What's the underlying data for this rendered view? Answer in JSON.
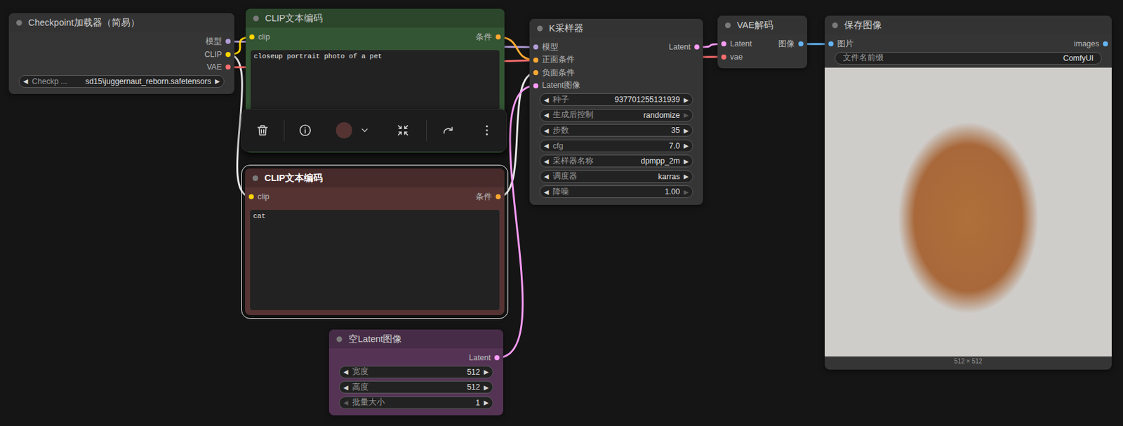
{
  "nodes": [
    {
      "title": "Checkpoint加载器（简易）",
      "color": "#353535",
      "title_color": "#333333",
      "selected": false,
      "inputs": [],
      "outputs": [
        {
          "label": "模型",
          "color": "#b39ddb"
        },
        {
          "label": "CLIP",
          "color": "#ffd500"
        },
        {
          "label": "VAE",
          "color": "#ff6e6e"
        }
      ],
      "widgets": [
        {
          "kind": "combo",
          "label": "Checkp ...",
          "value": "sd15\\juggernaut_reborn.safetensors",
          "left": "◀",
          "right": "▶",
          "left_disabled": false,
          "right_disabled": false
        }
      ]
    },
    {
      "title": "CLIP文本编码",
      "color": "#335533",
      "title_color": "#2b462b",
      "selected": false,
      "inputs": [
        {
          "label": "clip",
          "color": "#ffd500"
        }
      ],
      "outputs": [
        {
          "label": "条件",
          "color": "#ffa931"
        }
      ],
      "widgets": [
        {
          "kind": "text",
          "value": "closeup portrait photo of a pet"
        }
      ]
    },
    {
      "title": "CLIP文本编码",
      "color": "#553333",
      "title_color": "#472a2a",
      "selected": true,
      "inputs": [
        {
          "label": "clip",
          "color": "#ffd500"
        }
      ],
      "outputs": [
        {
          "label": "条件",
          "color": "#ffa931"
        }
      ],
      "widgets": [
        {
          "kind": "text",
          "value": "cat"
        }
      ]
    },
    {
      "title": "空Latent图像",
      "color": "#553355",
      "title_color": "#462c46",
      "selected": false,
      "inputs": [],
      "outputs": [
        {
          "label": "Latent",
          "color": "#ff9cf9"
        }
      ],
      "widgets": [
        {
          "kind": "number",
          "label": "宽度",
          "value": "512",
          "left": "◀",
          "right": "▶",
          "left_disabled": false,
          "right_disabled": false
        },
        {
          "kind": "number",
          "label": "高度",
          "value": "512",
          "left": "◀",
          "right": "▶",
          "left_disabled": false,
          "right_disabled": false
        },
        {
          "kind": "number",
          "label": "批量大小",
          "value": "1",
          "left": "◀",
          "right": "▶",
          "left_disabled": true,
          "right_disabled": false
        }
      ]
    },
    {
      "title": "K采样器",
      "color": "#353535",
      "title_color": "#333333",
      "selected": false,
      "inputs": [
        {
          "label": "模型",
          "color": "#b39ddb"
        },
        {
          "label": "正面条件",
          "color": "#ffa931"
        },
        {
          "label": "负面条件",
          "color": "#ffa931"
        },
        {
          "label": "Latent图像",
          "color": "#ff9cf9"
        }
      ],
      "outputs": [
        {
          "label": "Latent",
          "color": "#ff9cf9"
        }
      ],
      "widgets": [
        {
          "kind": "number",
          "label": "种子",
          "value": "937701255131939",
          "left": "◀",
          "right": "▶",
          "left_disabled": false,
          "right_disabled": false
        },
        {
          "kind": "combo",
          "label": "生成后控制",
          "value": "randomize",
          "left": "◀",
          "right": "▶",
          "left_disabled": false,
          "right_disabled": true
        },
        {
          "kind": "number",
          "label": "步数",
          "value": "35",
          "left": "◀",
          "right": "▶",
          "left_disabled": false,
          "right_disabled": false
        },
        {
          "kind": "number",
          "label": "cfg",
          "value": "7.0",
          "left": "◀",
          "right": "▶",
          "left_disabled": false,
          "right_disabled": false
        },
        {
          "kind": "combo",
          "label": "采样器名称",
          "value": "dpmpp_2m",
          "left": "◀",
          "right": "▶",
          "left_disabled": false,
          "right_disabled": false
        },
        {
          "kind": "combo",
          "label": "调度器",
          "value": "karras",
          "left": "◀",
          "right": "▶",
          "left_disabled": false,
          "right_disabled": false
        },
        {
          "kind": "number",
          "label": "降噪",
          "value": "1.00",
          "left": "◀",
          "right": "▶",
          "left_disabled": false,
          "right_disabled": true
        }
      ]
    },
    {
      "title": "VAE解码",
      "color": "#353535",
      "title_color": "#333333",
      "selected": false,
      "inputs": [
        {
          "label": "Latent",
          "color": "#ff9cf9"
        },
        {
          "label": "vae",
          "color": "#ff6e6e"
        }
      ],
      "outputs": [
        {
          "label": "图像",
          "color": "#64b5f6"
        }
      ],
      "widgets": []
    },
    {
      "title": "保存图像",
      "color": "#353535",
      "title_color": "#333333",
      "selected": false,
      "inputs": [
        {
          "label": "图片",
          "color": "#64b5f6"
        }
      ],
      "outputs": [
        {
          "label": "images",
          "color": "#64b5f6"
        }
      ],
      "widgets": [
        {
          "kind": "string",
          "label": "文件名前缀",
          "value": "ComfyUI"
        }
      ],
      "preview": {
        "footer": "512 × 512"
      }
    }
  ],
  "links": [
    {
      "from": [
        0,
        0
      ],
      "to": [
        4,
        0
      ],
      "color": "#b39ddb",
      "highlighted": false
    },
    {
      "from": [
        0,
        1
      ],
      "to": [
        1,
        0
      ],
      "color": "#ffd500",
      "highlighted": false
    },
    {
      "from": [
        0,
        1
      ],
      "to": [
        2,
        0
      ],
      "color": "#ffd500",
      "highlighted": true
    },
    {
      "from": [
        0,
        2
      ],
      "to": [
        5,
        1
      ],
      "color": "#ff6e6e",
      "highlighted": false
    },
    {
      "from": [
        1,
        0
      ],
      "to": [
        4,
        1
      ],
      "color": "#ffa931",
      "highlighted": false
    },
    {
      "from": [
        2,
        0
      ],
      "to": [
        4,
        2
      ],
      "color": "#ffa931",
      "highlighted": true
    },
    {
      "from": [
        3,
        0
      ],
      "to": [
        4,
        3
      ],
      "color": "#ff9cf9",
      "highlighted": false
    },
    {
      "from": [
        4,
        0
      ],
      "to": [
        5,
        0
      ],
      "color": "#ff9cf9",
      "highlighted": false
    },
    {
      "from": [
        5,
        0
      ],
      "to": [
        6,
        0
      ],
      "color": "#64b5f6",
      "highlighted": false
    }
  ]
}
